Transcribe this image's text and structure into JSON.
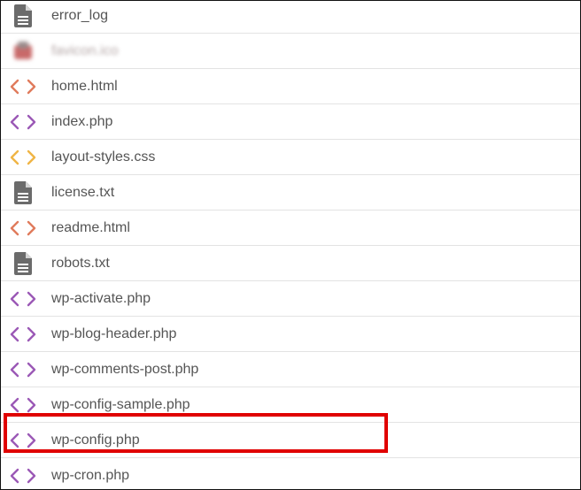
{
  "files": [
    {
      "name": "error_log",
      "icon": "document-icon",
      "kind": "doc"
    },
    {
      "name": "favicon.ico",
      "icon": "image-icon",
      "kind": "img",
      "blurred": true
    },
    {
      "name": "home.html",
      "icon": "code-icon",
      "kind": "code",
      "color": "#e07b5c"
    },
    {
      "name": "index.php",
      "icon": "code-icon",
      "kind": "code",
      "color": "#9b59b6"
    },
    {
      "name": "layout-styles.css",
      "icon": "code-icon",
      "kind": "code",
      "color": "#f0b545"
    },
    {
      "name": "license.txt",
      "icon": "document-icon",
      "kind": "doc"
    },
    {
      "name": "readme.html",
      "icon": "code-icon",
      "kind": "code",
      "color": "#e07b5c"
    },
    {
      "name": "robots.txt",
      "icon": "document-icon",
      "kind": "doc"
    },
    {
      "name": "wp-activate.php",
      "icon": "code-icon",
      "kind": "code",
      "color": "#9b59b6"
    },
    {
      "name": "wp-blog-header.php",
      "icon": "code-icon",
      "kind": "code",
      "color": "#9b59b6"
    },
    {
      "name": "wp-comments-post.php",
      "icon": "code-icon",
      "kind": "code",
      "color": "#9b59b6"
    },
    {
      "name": "wp-config-sample.php",
      "icon": "code-icon",
      "kind": "code",
      "color": "#9b59b6"
    },
    {
      "name": "wp-config.php",
      "icon": "code-icon",
      "kind": "code",
      "color": "#9b59b6",
      "highlighted": true
    },
    {
      "name": "wp-cron.php",
      "icon": "code-icon",
      "kind": "code",
      "color": "#9b59b6"
    }
  ],
  "colors": {
    "doc_icon": "#6b6b6b",
    "highlight": "#e00000",
    "text": "#555555"
  }
}
